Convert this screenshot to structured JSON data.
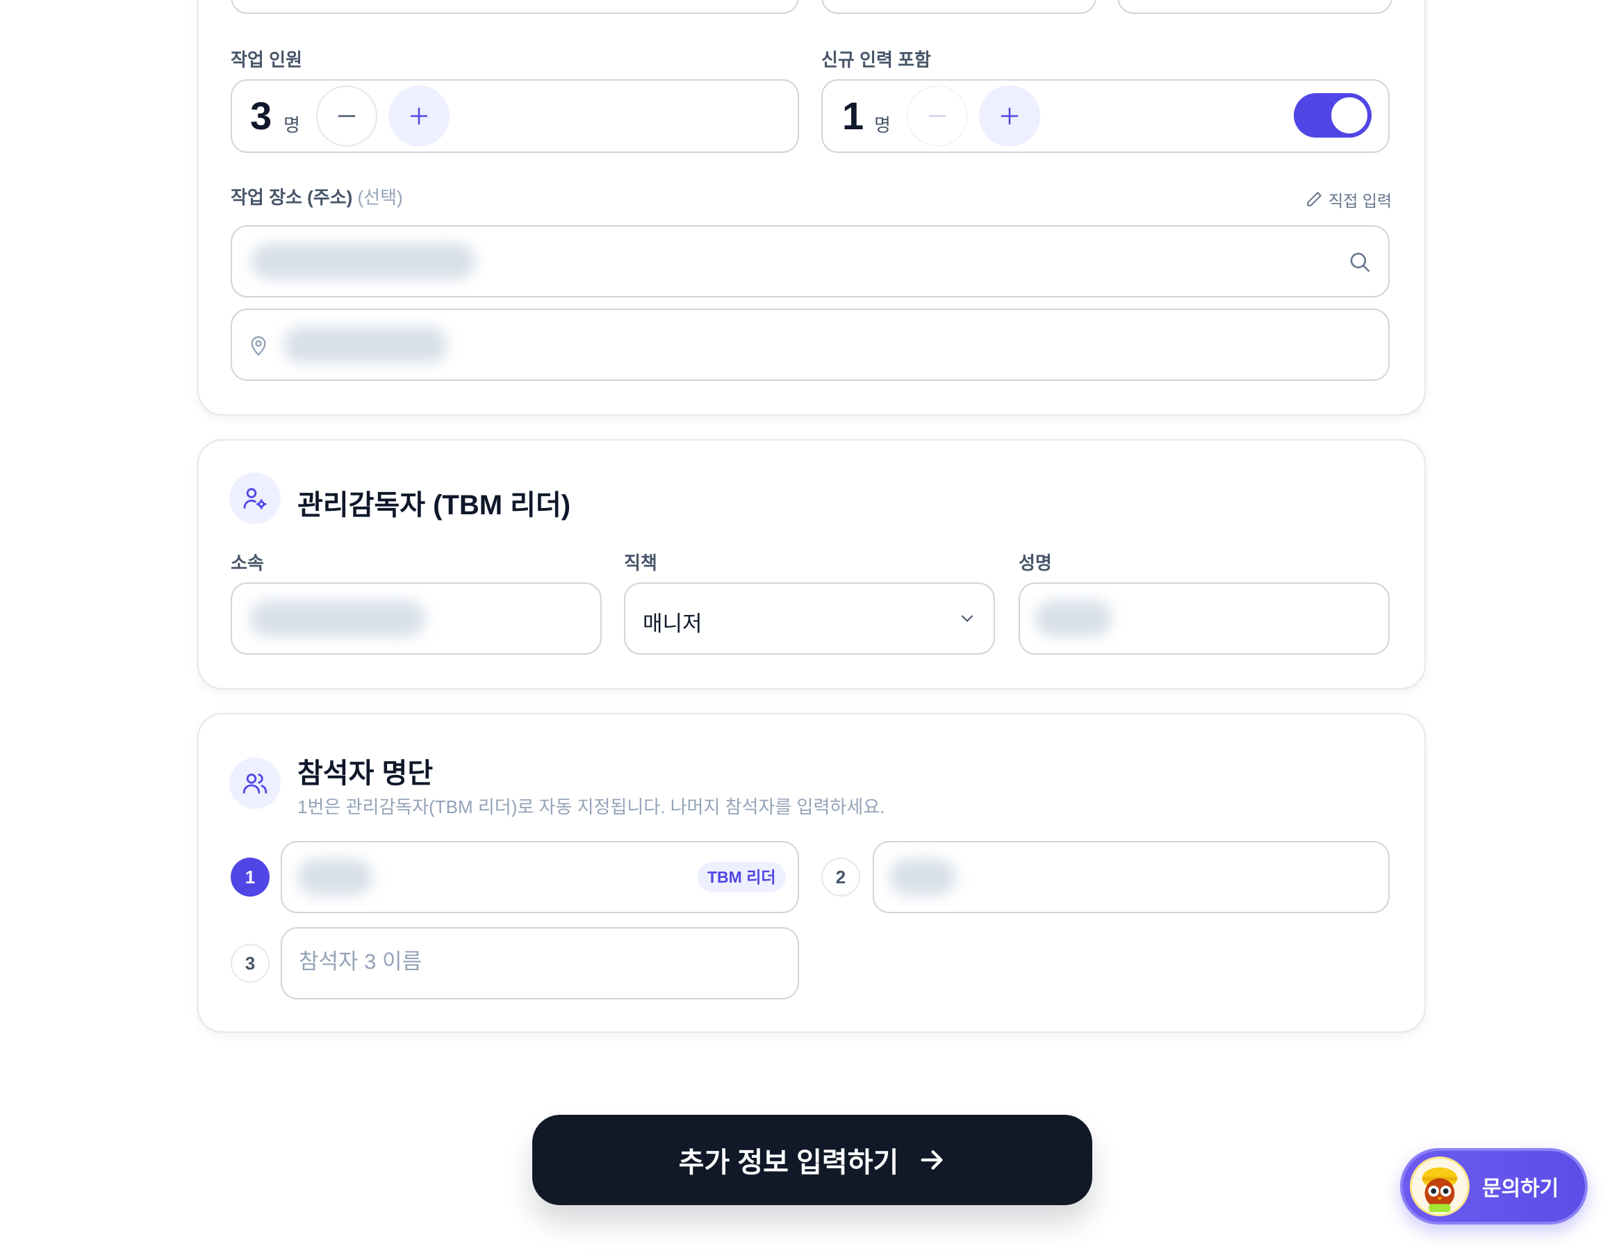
{
  "work_card": {
    "workers": {
      "label": "작업 인원",
      "count": "3",
      "unit": "명"
    },
    "new_workers": {
      "label": "신규 인력 포함",
      "count": "1",
      "unit": "명",
      "toggle_on": true
    },
    "location": {
      "label": "작업 장소 (주소)",
      "optional": "(선택)",
      "manual_link": "직접 입력"
    }
  },
  "supervisor": {
    "title": "관리감독자 (TBM 리더)",
    "affiliation_label": "소속",
    "position_label": "직책",
    "position_value": "매니저",
    "name_label": "성명"
  },
  "attendees": {
    "title": "참석자 명단",
    "subtitle": "1번은 관리감독자(TBM 리더)로 자동 지정됩니다. 나머지 참석자를 입력하세요.",
    "items": [
      {
        "number": "1",
        "tag": "TBM 리더",
        "active": true
      },
      {
        "number": "2",
        "active": false
      },
      {
        "number": "3",
        "placeholder": "참석자 3 이름",
        "active": false
      }
    ]
  },
  "cta": {
    "label": "추가 정보 입력하기"
  },
  "fab": {
    "label": "문의하기"
  },
  "colors": {
    "accent": "#4f46e5",
    "accent_light": "#eef0ff",
    "dark": "#111827"
  }
}
